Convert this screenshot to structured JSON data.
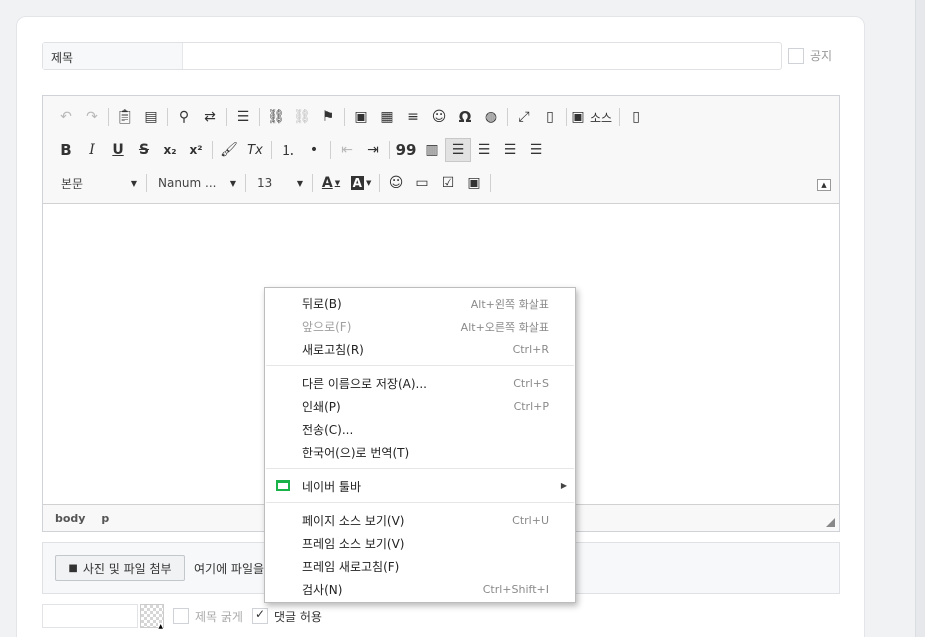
{
  "form": {
    "title_label": "제목",
    "title_value": "",
    "notice_label": "공지"
  },
  "toolbar": {
    "row1": [
      "undo-icon",
      "redo-icon",
      "paste-icon",
      "paste-word-icon",
      "find-icon",
      "replace-icon",
      "select-all-icon",
      "link-icon",
      "unlink-icon",
      "anchor-icon",
      "image-icon",
      "table-icon",
      "horizontal-rule-icon",
      "smiley-icon",
      "special-char-icon",
      "iframe-icon",
      "maximize-icon",
      "show-blocks-icon",
      "source-icon",
      "new-page-icon"
    ],
    "source_label": "소스",
    "special_char": "Ω",
    "bold_label": "B",
    "italic_label": "I",
    "underline_label": "U",
    "strike_label": "S",
    "subscript_label": "x₂",
    "superscript_label": "x²",
    "remove_format_label": "Tx",
    "blockquote_label": "99",
    "format_value": "본문",
    "font_value": "Nanum ...",
    "size_value": "13",
    "text_color_label": "A",
    "bg_color_label": "A"
  },
  "pathbar": {
    "elements": [
      "body",
      "p"
    ]
  },
  "attachments": {
    "button_label": "사진 및 파일 첨부",
    "hint": "여기에 파일을"
  },
  "options": {
    "bold_title_label": "제목 굵게",
    "bold_title_checked": false,
    "allow_comments_label": "댓글 허용",
    "allow_comments_checked": true
  },
  "context_menu": {
    "items": [
      {
        "label": "뒤로(B)",
        "shortcut": "Alt+왼쪽 화살표",
        "disabled": false
      },
      {
        "label": "앞으로(F)",
        "shortcut": "Alt+오른쪽 화살표",
        "disabled": true
      },
      {
        "label": "새로고침(R)",
        "shortcut": "Ctrl+R",
        "disabled": false
      },
      {
        "label": "다른 이름으로 저장(A)...",
        "shortcut": "Ctrl+S",
        "disabled": false
      },
      {
        "label": "인쇄(P)",
        "shortcut": "Ctrl+P",
        "disabled": false
      },
      {
        "label": "전송(C)...",
        "shortcut": "",
        "disabled": false
      },
      {
        "label": "한국어(으)로 번역(T)",
        "shortcut": "",
        "disabled": false
      },
      {
        "label": "네이버 툴바",
        "shortcut": "",
        "disabled": false,
        "icon": "naver-toolbar-icon",
        "submenu": true
      },
      {
        "label": "페이지 소스 보기(V)",
        "shortcut": "Ctrl+U",
        "disabled": false
      },
      {
        "label": "프레임 소스 보기(V)",
        "shortcut": "",
        "disabled": false
      },
      {
        "label": "프레임 새로고침(F)",
        "shortcut": "",
        "disabled": false
      },
      {
        "label": "검사(N)",
        "shortcut": "Ctrl+Shift+I",
        "disabled": false
      }
    ]
  }
}
